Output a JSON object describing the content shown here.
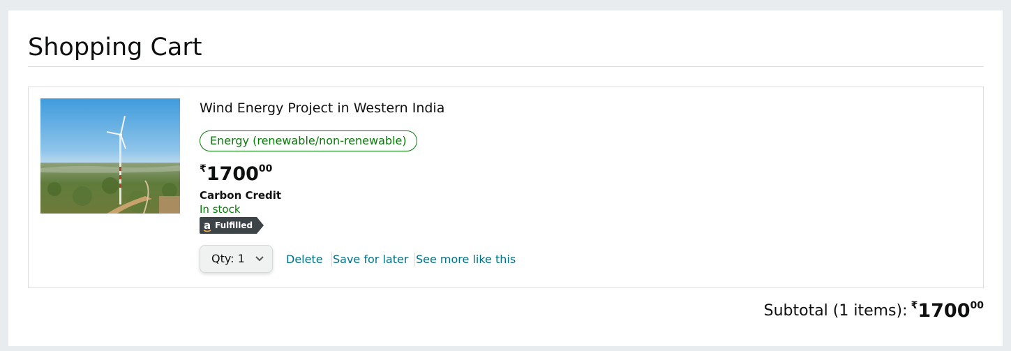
{
  "page": {
    "title": "Shopping Cart"
  },
  "cart": {
    "items": [
      {
        "name": "Wind Energy Project in Western India",
        "category": "Energy (renewable/non-renewable)",
        "price": {
          "currency": "₹",
          "whole": "1700",
          "fraction": "00"
        },
        "type": "Carbon Credit",
        "availability": "In stock",
        "badge": {
          "logo_letter": "a",
          "text": "Fulfilled",
          "icon": "amazon-fulfilled-badge"
        },
        "quantity": {
          "label": "Qty:",
          "value": "1"
        },
        "actions": {
          "delete": "Delete",
          "save_for_later": "Save for later",
          "see_more": "See more like this"
        },
        "image": {
          "icon": "wind-turbine-landscape-photo"
        }
      }
    ],
    "subtotal": {
      "label": "Subtotal (1 items):",
      "currency": "₹",
      "whole": "1700",
      "fraction": "00"
    }
  },
  "colors": {
    "background": "#e9ecee",
    "panel": "#ffffff",
    "text": "#0f1111",
    "in_stock_green": "#067d06",
    "link_teal": "#007185",
    "badge_dark": "#3d4448"
  }
}
